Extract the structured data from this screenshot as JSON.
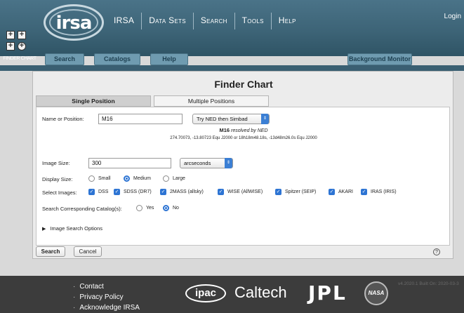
{
  "header": {
    "logo_text": "irsa",
    "nav": [
      "IRSA",
      "Data Sets",
      "Search",
      "Tools",
      "Help"
    ],
    "login": "Login"
  },
  "app": {
    "icon_label": "FINDER CHART",
    "subnav": {
      "search": "Search",
      "catalogs": "Catalogs",
      "help": "Help",
      "background_monitor": "Background Monitor"
    }
  },
  "panel": {
    "title": "Finder Chart",
    "tabs": [
      "Single Position",
      "Multiple Positions"
    ],
    "name_label": "Name or Position:",
    "name_value": "M16",
    "resolver": "Try NED then Simbad",
    "resolved_name": "M16",
    "resolved_by": "resolved by NED",
    "resolved_coords": "274.70073, -13.80723  Equ J2000   or   18h18m48.18s, -13d48m26.0s  Equ J2000",
    "image_size_label": "Image Size:",
    "image_size_value": "300",
    "image_size_unit": "arcseconds",
    "display_size_label": "Display Size:",
    "display_sizes": [
      "Small",
      "Medium",
      "Large"
    ],
    "display_selected": "Medium",
    "select_images_label": "Select Images:",
    "images": [
      "DSS",
      "SDSS (DR7)",
      "2MASS (allsky)",
      "WISE (AllWISE)",
      "Spitzer (SEIP)",
      "AKARI",
      "IRAS (IRIS)"
    ],
    "catalog_label": "Search Corresponding Catalog(s):",
    "catalog_options": [
      "Yes",
      "No"
    ],
    "catalog_selected": "No",
    "image_search_options": "Image Search Options",
    "search_button": "Search",
    "cancel_button": "Cancel",
    "help_icon": "?"
  },
  "footer": {
    "links": [
      "Contact",
      "Privacy Policy",
      "Acknowledge IRSA"
    ],
    "logos": {
      "ipac": "ipac",
      "caltech": "Caltech",
      "jpl": "JPL",
      "nasa": "NASA"
    },
    "version": "v4.2020.1 Built On: 2020-03-3"
  },
  "colors": {
    "banner": "#3d6477",
    "subnav": "#6f9bb0",
    "accent": "#2d74d3",
    "footer": "#3c3c3c"
  }
}
